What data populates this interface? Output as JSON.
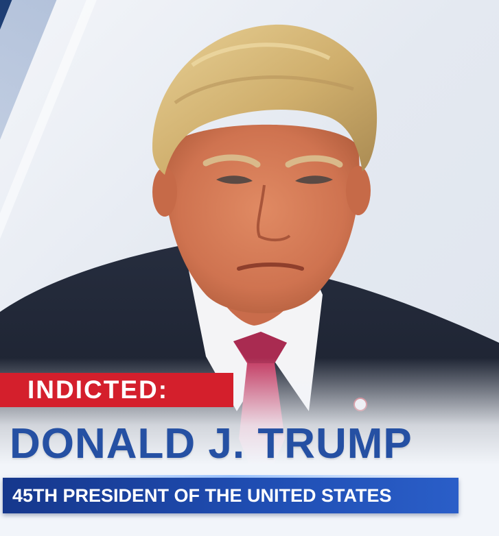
{
  "banner": {
    "tag_label": "INDICTED:",
    "headline": "DONALD J. TRUMP",
    "subtitle": "45TH PRESIDENT OF THE UNITED STATES"
  },
  "colors": {
    "tag_red": "#d41f2c",
    "headline_blue": "#2550a3",
    "subtitle_bar_blue": "#1f4db2",
    "suit": "#1c2231",
    "tie": "#c2375f"
  }
}
